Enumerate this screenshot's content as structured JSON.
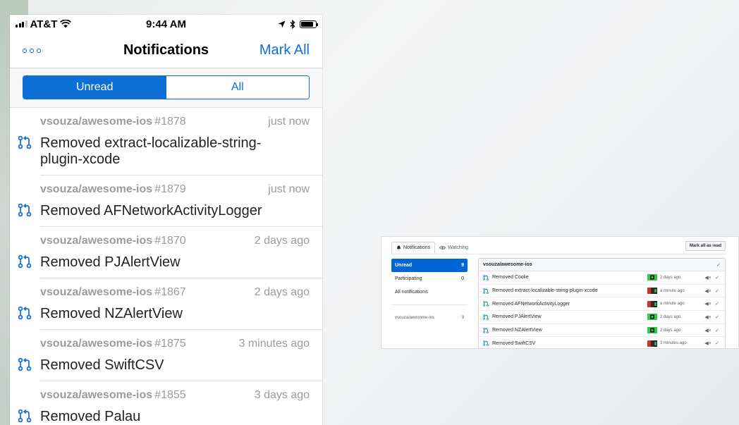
{
  "colors": {
    "accent": "#0b6fd6",
    "meta_gray": "#9b9b9f",
    "gh_blue": "#0366d6",
    "pr_icon": "#1e6fd0"
  },
  "phone": {
    "status": {
      "carrier": "AT&T",
      "time": "9:44 AM",
      "battery_level": 0.85,
      "signal_bars": 3,
      "icons": [
        "signal-icon",
        "wifi-icon",
        "location-arrow-icon",
        "bluetooth-icon",
        "battery-icon"
      ]
    },
    "nav": {
      "title": "Notifications",
      "action": "Mark All",
      "more_icon": "ellipsis-icon"
    },
    "filter": {
      "unread": "Unread",
      "all": "All",
      "selected": "Unread"
    },
    "notifications": [
      {
        "repo": "vsouza/awesome-ios",
        "number": "#1878",
        "time": "just now",
        "title_1": "Removed extract-localizable-string-",
        "title_2": "plugin-xcode",
        "icon": "pull-request-icon"
      },
      {
        "repo": "vsouza/awesome-ios",
        "number": "#1879",
        "time": "just now",
        "title_1": "Removed AFNetworkActivityLogger",
        "icon": "pull-request-icon"
      },
      {
        "repo": "vsouza/awesome-ios",
        "number": "#1870",
        "time": "2 days ago",
        "title_1": "Removed PJAlertView",
        "icon": "pull-request-icon"
      },
      {
        "repo": "vsouza/awesome-ios",
        "number": "#1867",
        "time": "2 days ago",
        "title_1": "Removed NZAlertView",
        "icon": "pull-request-icon"
      },
      {
        "repo": "vsouza/awesome-ios",
        "number": "#1875",
        "time": "3 minutes ago",
        "title_1": "Removed SwiftCSV",
        "icon": "pull-request-icon"
      },
      {
        "repo": "vsouza/awesome-ios",
        "number": "#1855",
        "time": "3 days ago",
        "title_1": "Removed Palau",
        "icon": "pull-request-icon"
      }
    ]
  },
  "desktop": {
    "tabs": {
      "notifications": "Notifications",
      "watching": "Watching"
    },
    "mark_all_read": "Mark all as read",
    "sidebar": {
      "unread": "Unread",
      "unread_count": "9",
      "participating": "Participating",
      "participating_count": "0",
      "all_notifications": "All notifications",
      "repo": "vsouza/awesome-ios",
      "repo_count": "9"
    },
    "list_header": "vsouza/awesome-ios",
    "items": [
      {
        "title": "Removed Coolie",
        "ago": "2 days ago",
        "avatar": "green"
      },
      {
        "title": "Removed extract-localizable-string-plugin-xcode",
        "ago": "a minute ago",
        "avatar": "photo"
      },
      {
        "title": "Removed AFNetworkActivityLogger",
        "ago": "a minute ago",
        "avatar": "photo"
      },
      {
        "title": "Removed PJAlertView",
        "ago": "2 days ago",
        "avatar": "green"
      },
      {
        "title": "Removed NZAlertView",
        "ago": "2 days ago",
        "avatar": "green"
      },
      {
        "title": "Removed SwiftCSV",
        "ago": "3 minutes ago",
        "avatar": "photo"
      }
    ]
  }
}
